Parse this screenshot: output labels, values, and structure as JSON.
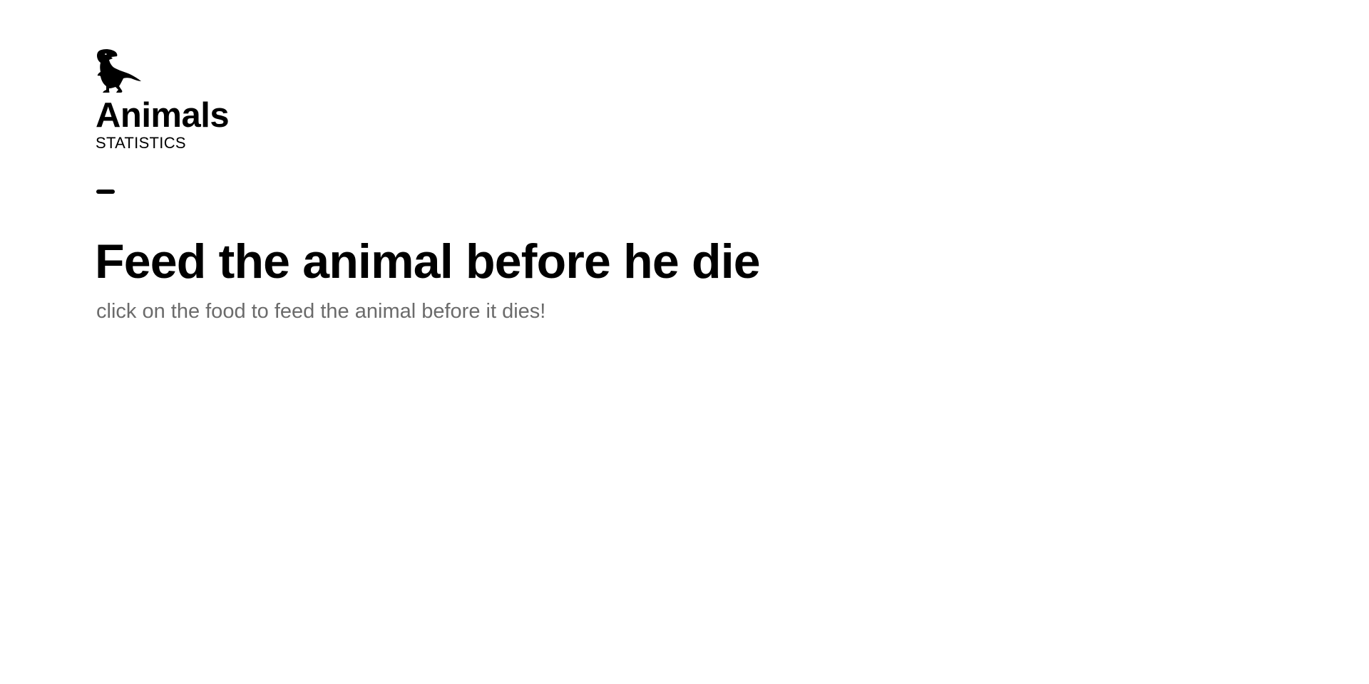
{
  "brand": {
    "logo_icon": "t-rex-icon",
    "name": "Animals",
    "subtitle": "STATISTICS"
  },
  "hero": {
    "title": "Feed the animal before he die",
    "subtitle": "click on the food to feed the animal before it dies!"
  },
  "colors": {
    "text": "#000000",
    "muted": "#6b6b6b",
    "background": "#ffffff"
  }
}
